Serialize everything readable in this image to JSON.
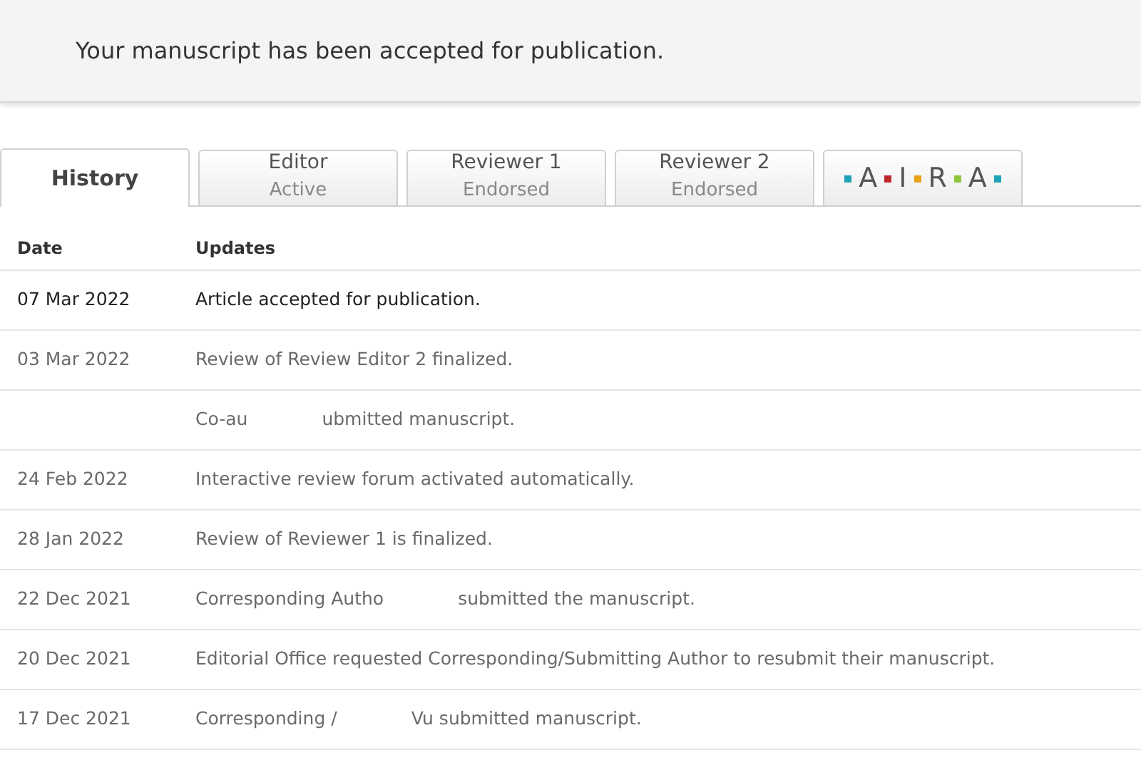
{
  "banner": {
    "message": "Your manuscript has been accepted for publication."
  },
  "tabs": [
    {
      "label": "History",
      "selected": true
    },
    {
      "label": "Editor",
      "status": "Active",
      "selected": false
    },
    {
      "label": "Reviewer 1",
      "status": "Endorsed",
      "selected": false
    },
    {
      "label": "Reviewer 2",
      "status": "Endorsed",
      "selected": false
    },
    {
      "kind": "logo",
      "letters": [
        "A",
        "I",
        "R",
        "A"
      ],
      "dots": [
        {
          "color": "#1fa3b8"
        },
        {
          "color": "#c0272d"
        },
        {
          "color": "#e8a317"
        },
        {
          "color": "#8dc63f"
        },
        {
          "color": "#1fa3b8"
        }
      ],
      "selected": false
    }
  ],
  "table": {
    "columns": [
      "Date",
      "Updates"
    ],
    "rows": [
      {
        "date": "07 Mar 2022",
        "update": [
          "Article accepted for publication."
        ],
        "highlighted": true
      },
      {
        "date": "03 Mar 2022",
        "update": [
          "Review of Review Editor 2 finalized."
        ],
        "highlighted": false
      },
      {
        "update": [
          "Co-au",
          "ubmitted manuscript."
        ],
        "highlighted": false
      },
      {
        "date": "24 Feb 2022",
        "update": [
          "Interactive review forum activated automatically."
        ],
        "highlighted": false
      },
      {
        "date": "28 Jan 2022",
        "update": [
          "Review of Reviewer 1 is finalized."
        ],
        "highlighted": false
      },
      {
        "date": "22 Dec 2021",
        "update": [
          "Corresponding Autho",
          "submitted the manuscript."
        ],
        "highlighted": false
      },
      {
        "date": "20 Dec 2021",
        "update": [
          "Editorial Office requested Corresponding/Submitting Author to resubmit their manuscript."
        ],
        "highlighted": false
      },
      {
        "date": "17 Dec 2021",
        "update": [
          "Corresponding /",
          "Vu submitted manuscript."
        ],
        "highlighted": false
      }
    ]
  }
}
